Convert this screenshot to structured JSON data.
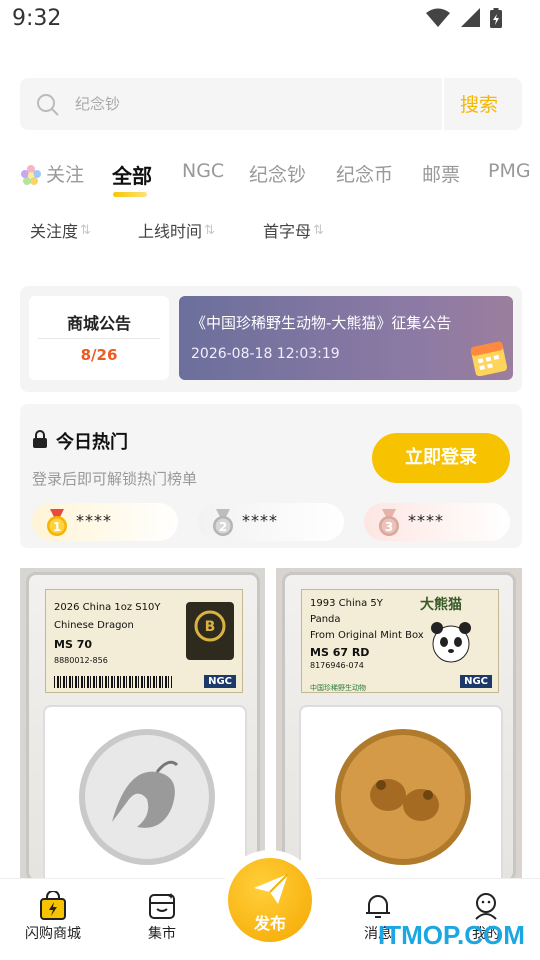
{
  "status_bar": {
    "time": "9:32"
  },
  "search": {
    "placeholder": "纪念钞",
    "button_label": "搜索"
  },
  "tabs": [
    {
      "label": "关注"
    },
    {
      "label": "全部",
      "active": true
    },
    {
      "label": "NGC"
    },
    {
      "label": "纪念钞"
    },
    {
      "label": "纪念币"
    },
    {
      "label": "邮票"
    },
    {
      "label": "PMG"
    }
  ],
  "sort_options": [
    {
      "label": "关注度"
    },
    {
      "label": "上线时间"
    },
    {
      "label": "首字母"
    }
  ],
  "notice": {
    "title": "商城公告",
    "page": "8/26",
    "headline": "《中国珍稀野生动物-大熊猫》征集公告",
    "timestamp": "2026-08-18 12:03:19"
  },
  "hot": {
    "title": "今日热门",
    "subtitle": "登录后即可解锁热门榜单",
    "login_label": "立即登录",
    "ranks": [
      {
        "medal": "1",
        "text": "****"
      },
      {
        "medal": "2",
        "text": "****"
      },
      {
        "medal": "3",
        "text": "****"
      }
    ]
  },
  "products": [
    {
      "label_lines": [
        "2026 China 1oz S10Y",
        "Chinese Dragon",
        "MS 70",
        "8880012-856"
      ],
      "grader": "NGC"
    },
    {
      "label_lines": [
        "1993 China 5Y",
        "Panda",
        "From Original Mint Box",
        "MS 67 RD",
        "8176946-074"
      ],
      "banner": "大熊猫",
      "label_footer": "中国珍稀野生动物",
      "grader": "NGC"
    }
  ],
  "bottom_nav": {
    "items": [
      {
        "label": "闪购商城",
        "icon": "shopping-bag-lightning-icon"
      },
      {
        "label": "集市",
        "icon": "market-box-icon"
      },
      {
        "label": "消息",
        "icon": "bell-icon"
      },
      {
        "label": "我的",
        "icon": "profile-icon"
      }
    ],
    "publish_label": "发布"
  },
  "watermark": "ITMOP.COM",
  "colors": {
    "accent": "#f7c200",
    "notice_date": "#ef5a22",
    "search_button": "#f5b800"
  }
}
